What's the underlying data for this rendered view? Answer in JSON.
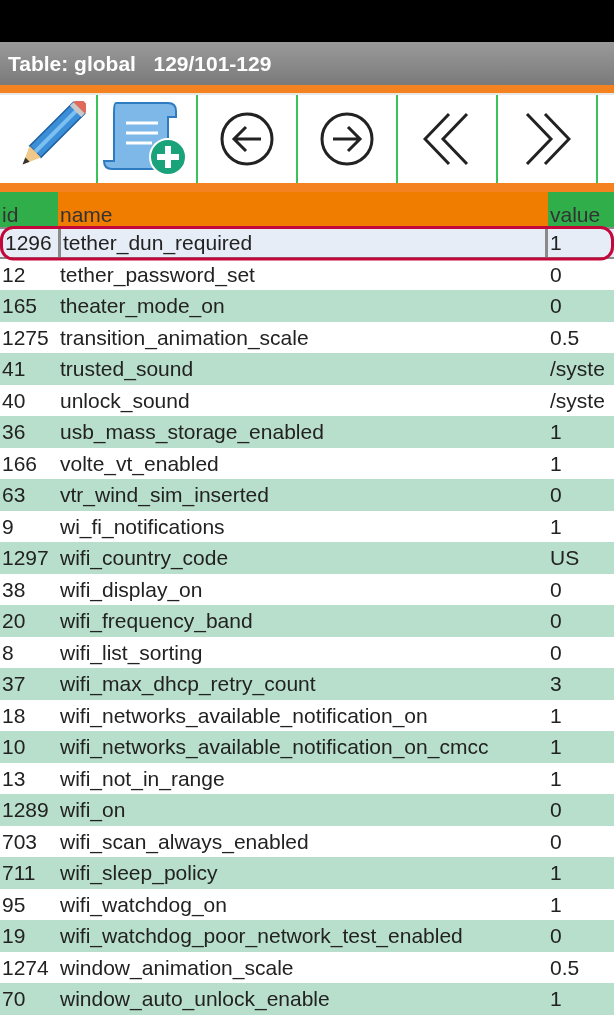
{
  "title_bar": {
    "title": "Table: global   129/101-129"
  },
  "toolbar": {
    "buttons": [
      {
        "kind": "edit"
      },
      {
        "kind": "add-script"
      },
      {
        "kind": "prev"
      },
      {
        "kind": "next"
      },
      {
        "kind": "first"
      },
      {
        "kind": "last"
      }
    ]
  },
  "table": {
    "columns": [
      "id",
      "name",
      "value"
    ],
    "rows": [
      {
        "id": "1296",
        "name": "tether_dun_required",
        "value": "1",
        "selected": true
      },
      {
        "id": "12",
        "name": "tether_password_set",
        "value": "0",
        "selected": false
      },
      {
        "id": "165",
        "name": "theater_mode_on",
        "value": "0",
        "selected": false
      },
      {
        "id": "1275",
        "name": "transition_animation_scale",
        "value": "0.5",
        "selected": false
      },
      {
        "id": "41",
        "name": "trusted_sound",
        "value": "/syste",
        "selected": false
      },
      {
        "id": "40",
        "name": "unlock_sound",
        "value": "/syste",
        "selected": false
      },
      {
        "id": "36",
        "name": "usb_mass_storage_enabled",
        "value": "1",
        "selected": false
      },
      {
        "id": "166",
        "name": "volte_vt_enabled",
        "value": "1",
        "selected": false
      },
      {
        "id": "63",
        "name": "vtr_wind_sim_inserted",
        "value": "0",
        "selected": false
      },
      {
        "id": "9",
        "name": "wi_fi_notifications",
        "value": "1",
        "selected": false
      },
      {
        "id": "1297",
        "name": "wifi_country_code",
        "value": "US",
        "selected": false
      },
      {
        "id": "38",
        "name": "wifi_display_on",
        "value": "0",
        "selected": false
      },
      {
        "id": "20",
        "name": "wifi_frequency_band",
        "value": "0",
        "selected": false
      },
      {
        "id": "8",
        "name": "wifi_list_sorting",
        "value": "0",
        "selected": false
      },
      {
        "id": "37",
        "name": "wifi_max_dhcp_retry_count",
        "value": "3",
        "selected": false
      },
      {
        "id": "18",
        "name": "wifi_networks_available_notification_on",
        "value": "1",
        "selected": false
      },
      {
        "id": "10",
        "name": "wifi_networks_available_notification_on_cmcc",
        "value": "1",
        "selected": false
      },
      {
        "id": "13",
        "name": "wifi_not_in_range",
        "value": "1",
        "selected": false
      },
      {
        "id": "1289",
        "name": "wifi_on",
        "value": "0",
        "selected": false
      },
      {
        "id": "703",
        "name": "wifi_scan_always_enabled",
        "value": "0",
        "selected": false
      },
      {
        "id": "711",
        "name": "wifi_sleep_policy",
        "value": "1",
        "selected": false
      },
      {
        "id": "95",
        "name": "wifi_watchdog_on",
        "value": "1",
        "selected": false
      },
      {
        "id": "19",
        "name": "wifi_watchdog_poor_network_test_enabled",
        "value": "0",
        "selected": false
      },
      {
        "id": "1274",
        "name": "window_animation_scale",
        "value": "0.5",
        "selected": false
      },
      {
        "id": "70",
        "name": "window_auto_unlock_enable",
        "value": "1",
        "selected": false
      }
    ]
  }
}
